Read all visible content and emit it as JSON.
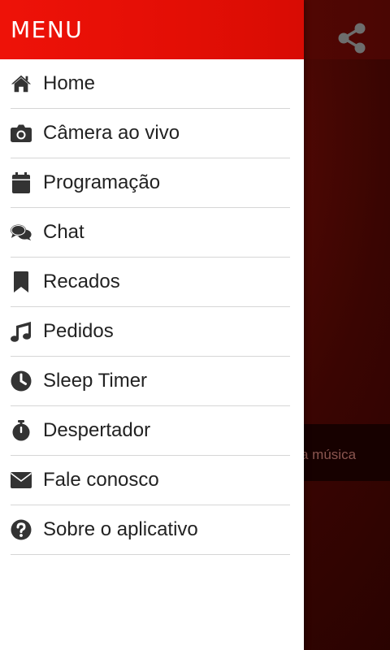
{
  "drawer": {
    "title": "MENU",
    "items": [
      {
        "label": "Home",
        "icon": "home-icon"
      },
      {
        "label": "Câmera ao vivo",
        "icon": "camera-icon"
      },
      {
        "label": "Programação",
        "icon": "calendar-icon"
      },
      {
        "label": "Chat",
        "icon": "chat-icon"
      },
      {
        "label": "Recados",
        "icon": "bookmark-icon"
      },
      {
        "label": "Pedidos",
        "icon": "music-icon"
      },
      {
        "label": "Sleep Timer",
        "icon": "clock-icon"
      },
      {
        "label": "Despertador",
        "icon": "stopwatch-icon"
      },
      {
        "label": "Fale conosco",
        "icon": "envelope-icon"
      },
      {
        "label": "Sobre o aplicativo",
        "icon": "question-icon"
      }
    ]
  },
  "background": {
    "now_playing_text": "a música",
    "share_icon": "share-icon"
  },
  "colors": {
    "header": "#e8100a",
    "icon": "#333333",
    "text": "#222222",
    "divider": "#d6d6d6"
  }
}
